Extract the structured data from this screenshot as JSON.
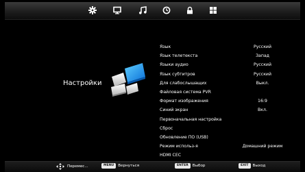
{
  "top_tabs": [
    {
      "name": "settings-gear-icon"
    },
    {
      "name": "monitor-icon"
    },
    {
      "name": "music-note-icon"
    },
    {
      "name": "clock-icon"
    },
    {
      "name": "lock-icon"
    },
    {
      "name": "grid-icon"
    }
  ],
  "section_title": "Настройки",
  "menu": {
    "items": [
      {
        "label": "Язык",
        "value": "Русский"
      },
      {
        "label": "Язык телетекста",
        "value": "Запад"
      },
      {
        "label": "Языки аудио",
        "value": "Русский"
      },
      {
        "label": "Язык субтитров",
        "value": "Русский"
      },
      {
        "label": "Для слабослышащих",
        "value": "Выкл."
      },
      {
        "label": "Файловая система PVR",
        "value": ""
      },
      {
        "label": "Формат изображения",
        "value": "16:9"
      },
      {
        "label": "Синий экран",
        "value": "Вкл."
      },
      {
        "label": "Первоначальная настройка",
        "value": ""
      },
      {
        "label": "Сброс",
        "value": ""
      },
      {
        "label": "Обновление ПО (USB)",
        "value": ""
      },
      {
        "label": "Режим использ-я",
        "value": "Домашний режим"
      },
      {
        "label": "HDMI CEC",
        "value": ""
      }
    ]
  },
  "footer": {
    "move_label": "Перемес...",
    "menu_key": "MENU",
    "menu_label": "Вернуться",
    "enter_key": "ENTER",
    "enter_label": "Выбор",
    "exit_key": "EXIT",
    "exit_label": "Выход"
  }
}
